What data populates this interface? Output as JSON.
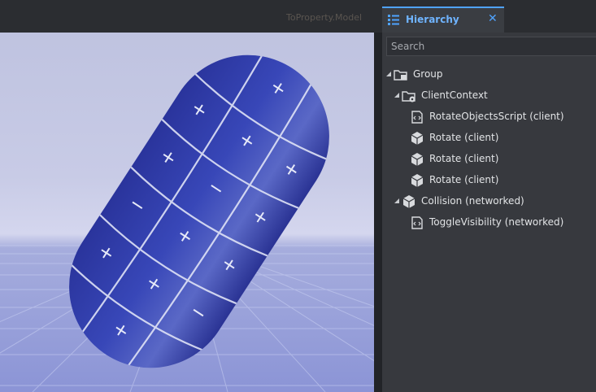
{
  "viewport": {
    "faded_title": "ToProperty.Model"
  },
  "hierarchy": {
    "tab_label": "Hierarchy",
    "close_glyph": "✕",
    "search_placeholder": "Search",
    "accent_color": "#4fa3ff",
    "items": [
      {
        "label": "Group",
        "icon": "folder-group-icon",
        "expanded": true
      },
      {
        "label": "ClientContext",
        "icon": "client-context-folder-icon",
        "expanded": true
      },
      {
        "label": "RotateObjectsScript (client)",
        "icon": "script-icon"
      },
      {
        "label": "Rotate (client)",
        "icon": "cube-icon"
      },
      {
        "label": "Rotate (client)",
        "icon": "cube-icon"
      },
      {
        "label": "Rotate (client)",
        "icon": "cube-icon"
      },
      {
        "label": "Collision (networked)",
        "icon": "cube-icon",
        "expanded": true
      },
      {
        "label": "ToggleVisibility (networked)",
        "icon": "script-icon"
      }
    ]
  }
}
